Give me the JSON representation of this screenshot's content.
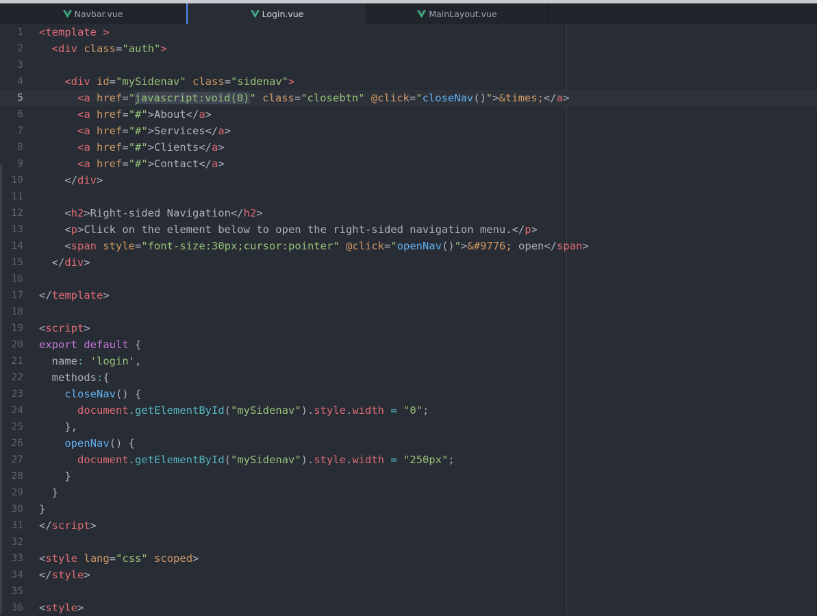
{
  "tabs": [
    {
      "label": "Navbar.vue",
      "active": false,
      "icon": "vue-icon"
    },
    {
      "label": "Login.vue",
      "active": true,
      "icon": "vue-icon"
    },
    {
      "label": "MainLayout.vue",
      "active": false,
      "icon": "vue-icon"
    }
  ],
  "editor": {
    "cursor_line": 5,
    "lines": [
      [
        [
          "tag",
          "<template >"
        ]
      ],
      [
        [
          "pr",
          "  "
        ],
        [
          "tag",
          "<div"
        ],
        [
          "pr",
          " "
        ],
        [
          "attr",
          "class"
        ],
        [
          "pr",
          "="
        ],
        [
          "str",
          "\"auth\""
        ],
        [
          "tag",
          ">"
        ]
      ],
      [],
      [
        [
          "pr",
          "    "
        ],
        [
          "tag",
          "<div"
        ],
        [
          "pr",
          " "
        ],
        [
          "attr",
          "id"
        ],
        [
          "pr",
          "="
        ],
        [
          "str",
          "\"mySidenav\""
        ],
        [
          "pr",
          " "
        ],
        [
          "attr",
          "class"
        ],
        [
          "pr",
          "="
        ],
        [
          "str",
          "\"sidenav\""
        ],
        [
          "tag",
          ">"
        ]
      ],
      [
        [
          "pr",
          "      "
        ],
        [
          "tag",
          "<a"
        ],
        [
          "pr",
          " "
        ],
        [
          "attr",
          "href"
        ],
        [
          "pr",
          "="
        ],
        [
          "str",
          "\""
        ],
        [
          "caret",
          ""
        ],
        [
          "strsel",
          "javascript:void(0)"
        ],
        [
          "str",
          "\""
        ],
        [
          "pr",
          " "
        ],
        [
          "attr",
          "class"
        ],
        [
          "pr",
          "="
        ],
        [
          "str",
          "\"closebtn\""
        ],
        [
          "pr",
          " "
        ],
        [
          "attr",
          "@click"
        ],
        [
          "pr",
          "="
        ],
        [
          "str",
          "\""
        ],
        [
          "fn",
          "closeNav"
        ],
        [
          "pr",
          "()"
        ],
        [
          "str",
          "\""
        ],
        [
          "pr",
          ">"
        ],
        [
          "ent",
          "&times;"
        ],
        [
          "pr",
          "</"
        ],
        [
          "tag",
          "a"
        ],
        [
          "pr",
          ">"
        ]
      ],
      [
        [
          "pr",
          "      "
        ],
        [
          "tag",
          "<a"
        ],
        [
          "pr",
          " "
        ],
        [
          "attr",
          "href"
        ],
        [
          "pr",
          "="
        ],
        [
          "str",
          "\"#\""
        ],
        [
          "pr",
          ">About</"
        ],
        [
          "tag",
          "a"
        ],
        [
          "pr",
          ">"
        ]
      ],
      [
        [
          "pr",
          "      "
        ],
        [
          "tag",
          "<a"
        ],
        [
          "pr",
          " "
        ],
        [
          "attr",
          "href"
        ],
        [
          "pr",
          "="
        ],
        [
          "str",
          "\"#\""
        ],
        [
          "pr",
          ">Services</"
        ],
        [
          "tag",
          "a"
        ],
        [
          "pr",
          ">"
        ]
      ],
      [
        [
          "pr",
          "      "
        ],
        [
          "tag",
          "<a"
        ],
        [
          "pr",
          " "
        ],
        [
          "attr",
          "href"
        ],
        [
          "pr",
          "="
        ],
        [
          "str",
          "\"#\""
        ],
        [
          "pr",
          ">Clients</"
        ],
        [
          "tag",
          "a"
        ],
        [
          "pr",
          ">"
        ]
      ],
      [
        [
          "pr",
          "      "
        ],
        [
          "tag",
          "<a"
        ],
        [
          "pr",
          " "
        ],
        [
          "attr",
          "href"
        ],
        [
          "pr",
          "="
        ],
        [
          "str",
          "\"#\""
        ],
        [
          "pr",
          ">Contact</"
        ],
        [
          "tag",
          "a"
        ],
        [
          "pr",
          ">"
        ]
      ],
      [
        [
          "pr",
          "    </"
        ],
        [
          "tag",
          "div"
        ],
        [
          "pr",
          ">"
        ]
      ],
      [],
      [
        [
          "pr",
          "    <"
        ],
        [
          "tag",
          "h2"
        ],
        [
          "pr",
          ">Right-sided Navigation</"
        ],
        [
          "tag",
          "h2"
        ],
        [
          "pr",
          ">"
        ]
      ],
      [
        [
          "pr",
          "    <"
        ],
        [
          "tag",
          "p"
        ],
        [
          "pr",
          ">Click on the element below to open the right-sided navigation menu.</"
        ],
        [
          "tag",
          "p"
        ],
        [
          "pr",
          ">"
        ]
      ],
      [
        [
          "pr",
          "    <"
        ],
        [
          "tag",
          "span"
        ],
        [
          "pr",
          " "
        ],
        [
          "attr",
          "style"
        ],
        [
          "pr",
          "="
        ],
        [
          "str",
          "\"font-size:30px;cursor:pointer\""
        ],
        [
          "pr",
          " "
        ],
        [
          "attr",
          "@click"
        ],
        [
          "pr",
          "="
        ],
        [
          "str",
          "\""
        ],
        [
          "fn",
          "openNav"
        ],
        [
          "pr",
          "()"
        ],
        [
          "str",
          "\""
        ],
        [
          "pr",
          ">"
        ],
        [
          "ent",
          "&#9776;"
        ],
        [
          "pr",
          " open</"
        ],
        [
          "tag",
          "span"
        ],
        [
          "pr",
          ">"
        ]
      ],
      [
        [
          "pr",
          "  </"
        ],
        [
          "tag",
          "div"
        ],
        [
          "pr",
          ">"
        ]
      ],
      [],
      [
        [
          "pr",
          "</"
        ],
        [
          "tag",
          "template"
        ],
        [
          "pr",
          ">"
        ]
      ],
      [],
      [
        [
          "pr",
          "<"
        ],
        [
          "tag",
          "script"
        ],
        [
          "pr",
          ">"
        ]
      ],
      [
        [
          "kw",
          "export"
        ],
        [
          "pr",
          " "
        ],
        [
          "kw",
          "default"
        ],
        [
          "pr",
          " {"
        ]
      ],
      [
        [
          "pr",
          "  name"
        ],
        [
          "meth",
          ":"
        ],
        [
          "pr",
          " "
        ],
        [
          "str",
          "'login'"
        ],
        [
          "pr",
          ","
        ]
      ],
      [
        [
          "pr",
          "  methods"
        ],
        [
          "meth",
          ":"
        ],
        [
          "pr",
          "{"
        ]
      ],
      [
        [
          "pr",
          "    "
        ],
        [
          "fn",
          "closeNav"
        ],
        [
          "pr",
          "() {"
        ]
      ],
      [
        [
          "pr",
          "      "
        ],
        [
          "obj",
          "document"
        ],
        [
          "pr",
          "."
        ],
        [
          "meth",
          "getElementById"
        ],
        [
          "pr",
          "("
        ],
        [
          "str",
          "\"mySidenav\""
        ],
        [
          "pr",
          ")."
        ],
        [
          "obj",
          "style"
        ],
        [
          "pr",
          "."
        ],
        [
          "obj",
          "width"
        ],
        [
          "pr",
          " "
        ],
        [
          "meth",
          "="
        ],
        [
          "pr",
          " "
        ],
        [
          "str",
          "\"0\""
        ],
        [
          "pr",
          ";"
        ]
      ],
      [
        [
          "pr",
          "    },"
        ]
      ],
      [
        [
          "pr",
          "    "
        ],
        [
          "fn",
          "openNav"
        ],
        [
          "pr",
          "() {"
        ]
      ],
      [
        [
          "pr",
          "      "
        ],
        [
          "obj",
          "document"
        ],
        [
          "pr",
          "."
        ],
        [
          "meth",
          "getElementById"
        ],
        [
          "pr",
          "("
        ],
        [
          "str",
          "\"mySidenav\""
        ],
        [
          "pr",
          ")."
        ],
        [
          "obj",
          "style"
        ],
        [
          "pr",
          "."
        ],
        [
          "obj",
          "width"
        ],
        [
          "pr",
          " "
        ],
        [
          "meth",
          "="
        ],
        [
          "pr",
          " "
        ],
        [
          "str",
          "\"250px\""
        ],
        [
          "pr",
          ";"
        ]
      ],
      [
        [
          "pr",
          "    }"
        ]
      ],
      [
        [
          "pr",
          "  }"
        ]
      ],
      [
        [
          "pr",
          "}"
        ]
      ],
      [
        [
          "pr",
          "</"
        ],
        [
          "tag",
          "script"
        ],
        [
          "pr",
          ">"
        ]
      ],
      [],
      [
        [
          "pr",
          "<"
        ],
        [
          "tag",
          "style"
        ],
        [
          "pr",
          " "
        ],
        [
          "attr",
          "lang"
        ],
        [
          "pr",
          "="
        ],
        [
          "str",
          "\"css\""
        ],
        [
          "pr",
          " "
        ],
        [
          "attr",
          "scoped"
        ],
        [
          "pr",
          ">"
        ]
      ],
      [
        [
          "pr",
          "</"
        ],
        [
          "tag",
          "style"
        ],
        [
          "pr",
          ">"
        ]
      ],
      [],
      [
        [
          "pr",
          "<"
        ],
        [
          "tag",
          "style"
        ],
        [
          "pr",
          ">"
        ]
      ]
    ]
  },
  "colors": {
    "background": "#282c34",
    "tag": "#e06c75",
    "attribute": "#d19a66",
    "string": "#98c379",
    "function": "#61afef",
    "keyword": "#c678dd",
    "method": "#56b6c2",
    "vue_green": "#41b883"
  }
}
